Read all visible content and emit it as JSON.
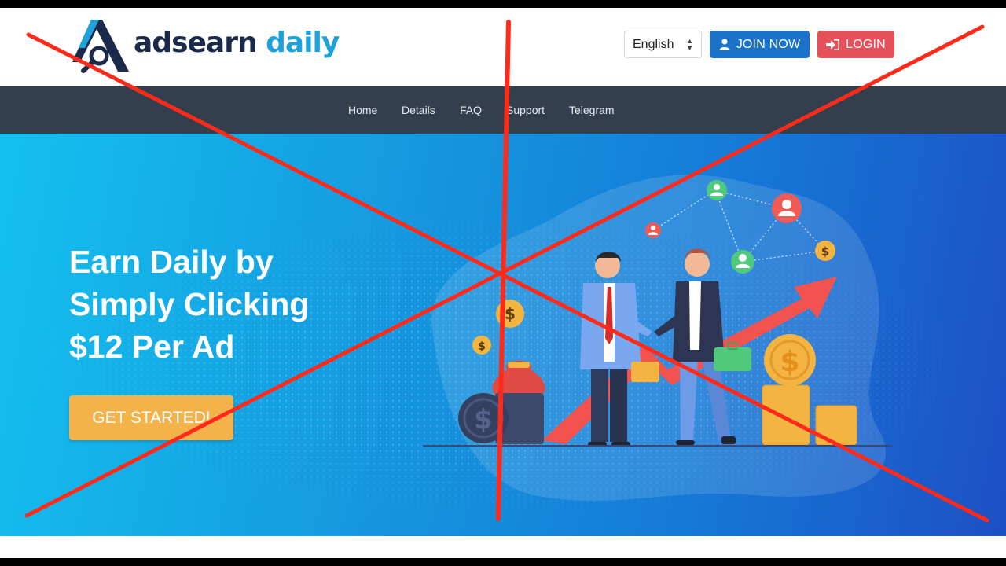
{
  "brand": {
    "name_part1": "adsearn",
    "name_part2": "daily",
    "colors": {
      "navy": "#1b2a4a",
      "accent": "#1ea2dc"
    }
  },
  "header": {
    "language": {
      "selected": "English"
    },
    "join_button": {
      "label": "JOIN NOW",
      "icon": "user-icon",
      "color": "#1a73c9"
    },
    "login_button": {
      "label": "LOGIN",
      "icon": "sign-in-icon",
      "color": "#e5505a"
    }
  },
  "nav": {
    "items": [
      {
        "label": "Home"
      },
      {
        "label": "Details"
      },
      {
        "label": "FAQ"
      },
      {
        "label": "Support"
      },
      {
        "label": "Telegram"
      }
    ]
  },
  "hero": {
    "title_lines": [
      "Earn Daily by",
      "Simply Clicking",
      "$12 Per Ad"
    ],
    "cta_label": "GET STARTED!",
    "cta_color": "#f4b24b",
    "coin_symbol": "$"
  },
  "overlay": {
    "type": "red-x-cross",
    "color": "#ff2a1a"
  }
}
